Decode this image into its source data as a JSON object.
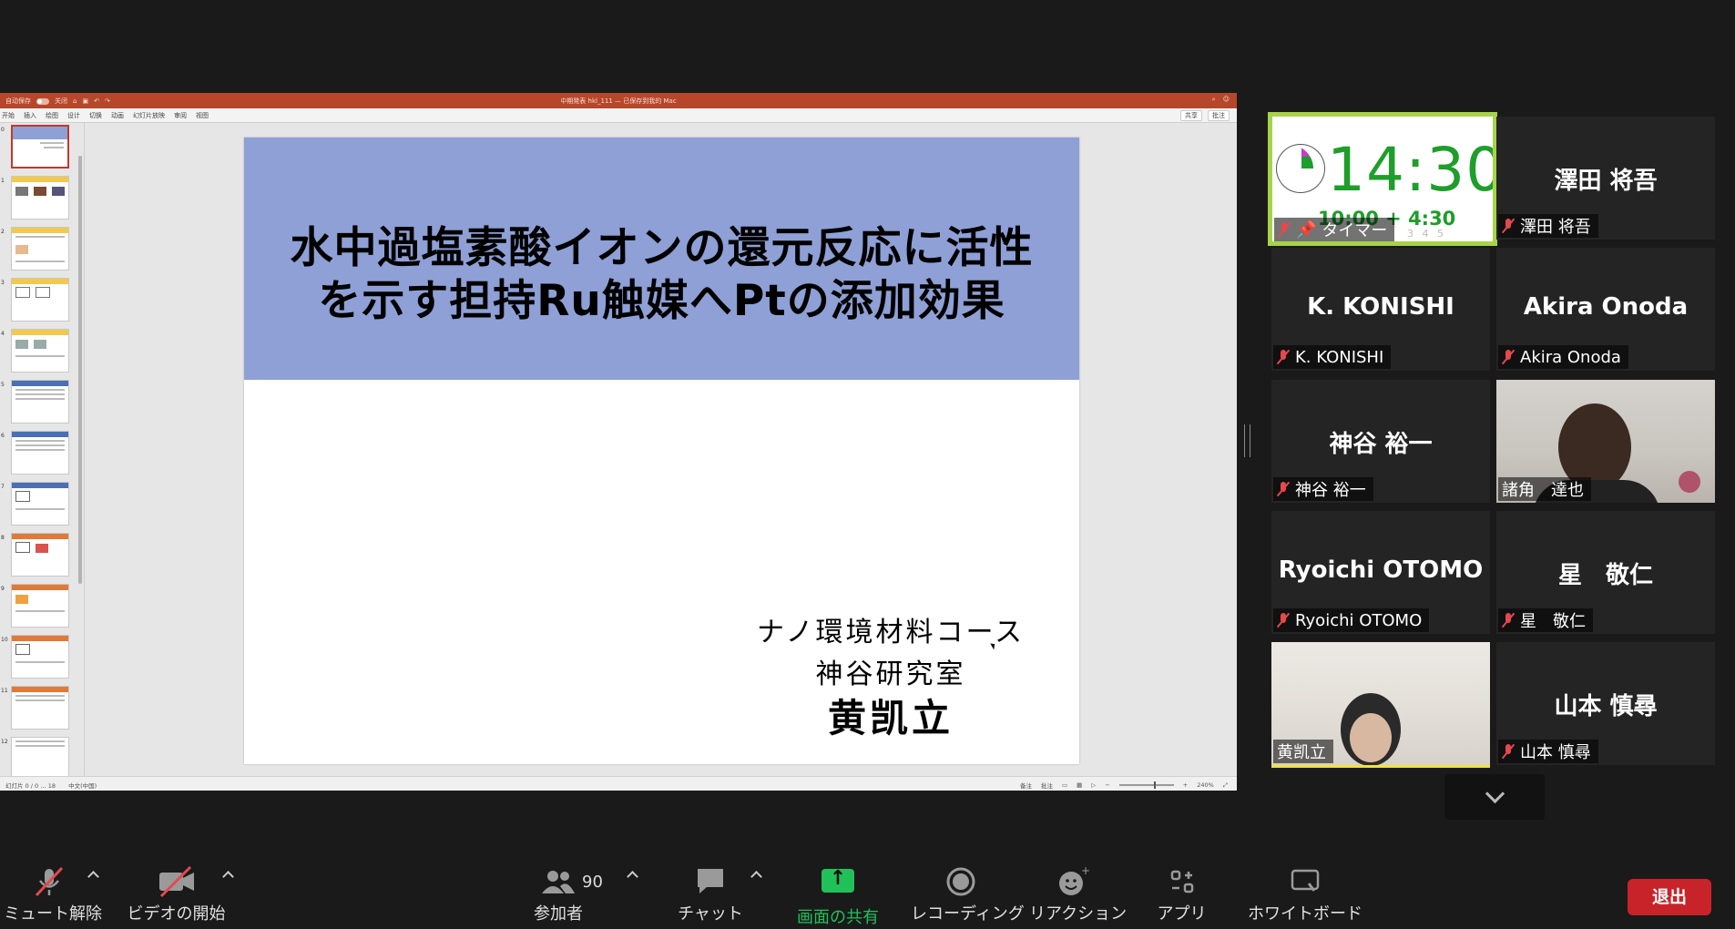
{
  "powerpoint": {
    "autosave_label": "自动保存",
    "autosave_state": "关闭",
    "window_title": "中期発表 hkl_111 — 已保存到我的 Mac",
    "menu": [
      "开始",
      "插入",
      "绘图",
      "设计",
      "切换",
      "动画",
      "幻灯片放映",
      "审阅",
      "视图"
    ],
    "share_label": "共享",
    "comment_label": "批注",
    "slide_numbers": [
      "0",
      "1",
      "2",
      "3",
      "4",
      "5",
      "6",
      "7",
      "8",
      "9",
      "10",
      "11",
      "12"
    ],
    "status_slide": "幻灯片 0 / 0 … 18",
    "status_language": "中文(中国)",
    "status_notes": "备注",
    "status_comments": "批注",
    "status_zoom": "240%"
  },
  "slide": {
    "title_line1": "水中過塩素酸イオンの還元反応に活性",
    "title_line2": "を示す担持Ru触媒へPtの添加効果",
    "affiliation_course": "ナノ環境材料コース",
    "affiliation_lab": "神谷研究室",
    "presenter": "黄凯立",
    "header_color": "#8ea0d6"
  },
  "gallery": {
    "timer": {
      "time": "14:30",
      "sub": "10:00 + 4:30",
      "ticks": "3 4 5",
      "label": "タイマー"
    },
    "tiles": [
      {
        "name": "澤田 将吾",
        "label": "澤田 将吾"
      },
      {
        "name": "K. KONISHI",
        "label": "K. KONISHI"
      },
      {
        "name": "Akira Onoda",
        "label": "Akira Onoda"
      },
      {
        "name": "神谷 裕一",
        "label": "神谷 裕一"
      },
      {
        "name": "",
        "label": "諸角　達也"
      },
      {
        "name": "Ryoichi OTOMO",
        "label": "Ryoichi OTOMO"
      },
      {
        "name": "星　敬仁",
        "label": "星　敬仁"
      },
      {
        "name": "",
        "label": "黄凯立"
      },
      {
        "name": "山本 慎尋",
        "label": "山本 慎尋"
      }
    ]
  },
  "toolbar": {
    "unmute": "ミュート解除",
    "start_video": "ビデオの開始",
    "participants": "参加者",
    "participant_count": "90",
    "chat": "チャット",
    "share_screen": "画面の共有",
    "recording": "レコーディング",
    "reactions": "リアクション",
    "apps": "アプリ",
    "whiteboard": "ホワイトボード",
    "exit": "退出",
    "share_color": "#21c15a",
    "exit_color": "#c9232a"
  }
}
